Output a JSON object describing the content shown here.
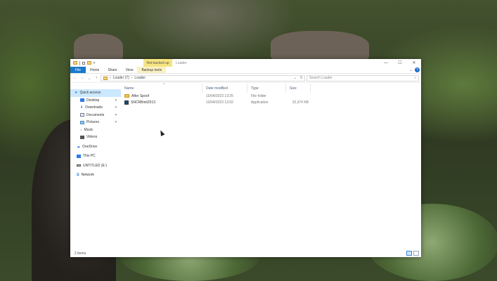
{
  "window": {
    "title": "Loader",
    "context_tab_group": "Not backed up",
    "controls": {
      "minimize": "—",
      "maximize": "☐",
      "close": "✕"
    }
  },
  "ribbon": {
    "tabs": [
      "File",
      "Home",
      "Share",
      "View",
      "Backup tools"
    ],
    "help": "?"
  },
  "address": {
    "path": [
      "Loader (7)",
      "Loader"
    ],
    "search_placeholder": "Search Loader"
  },
  "nav": {
    "items": [
      {
        "label": "Quick access",
        "icon": "star-icon",
        "color": "#2c7be5"
      },
      {
        "label": "Desktop",
        "icon": "desktop-icon",
        "color": "#2c7be5"
      },
      {
        "label": "Downloads",
        "icon": "download-icon",
        "color": "#2c7be5"
      },
      {
        "label": "Documents",
        "icon": "documents-icon",
        "color": "#6c7a89"
      },
      {
        "label": "Pictures",
        "icon": "pictures-icon",
        "color": "#4a90c2"
      },
      {
        "label": "Music",
        "icon": "music-icon",
        "color": "#2c7be5"
      },
      {
        "label": "Videos",
        "icon": "videos-icon",
        "color": "#555"
      },
      {
        "label": "OneDrive",
        "icon": "cloud-icon",
        "color": "#1a73e8"
      },
      {
        "label": "This PC",
        "icon": "computer-icon",
        "color": "#2c7be5"
      },
      {
        "label": "UNTITLED (E:)",
        "icon": "drive-icon",
        "color": "#555"
      },
      {
        "label": "Network",
        "icon": "network-icon",
        "color": "#2c7be5"
      }
    ]
  },
  "columns": [
    "Name",
    "Date modified",
    "Type",
    "Size"
  ],
  "files": [
    {
      "name": "After Spoof",
      "date": "10/04/2023 13:25",
      "type": "File folder",
      "size": "",
      "icon": "folder-icon"
    },
    {
      "name": "SNCRBinit2013",
      "date": "10/04/2023 13:02",
      "type": "Application",
      "size": "10,374 KB",
      "icon": "application-icon"
    }
  ],
  "status": {
    "item_count": "2 items"
  }
}
